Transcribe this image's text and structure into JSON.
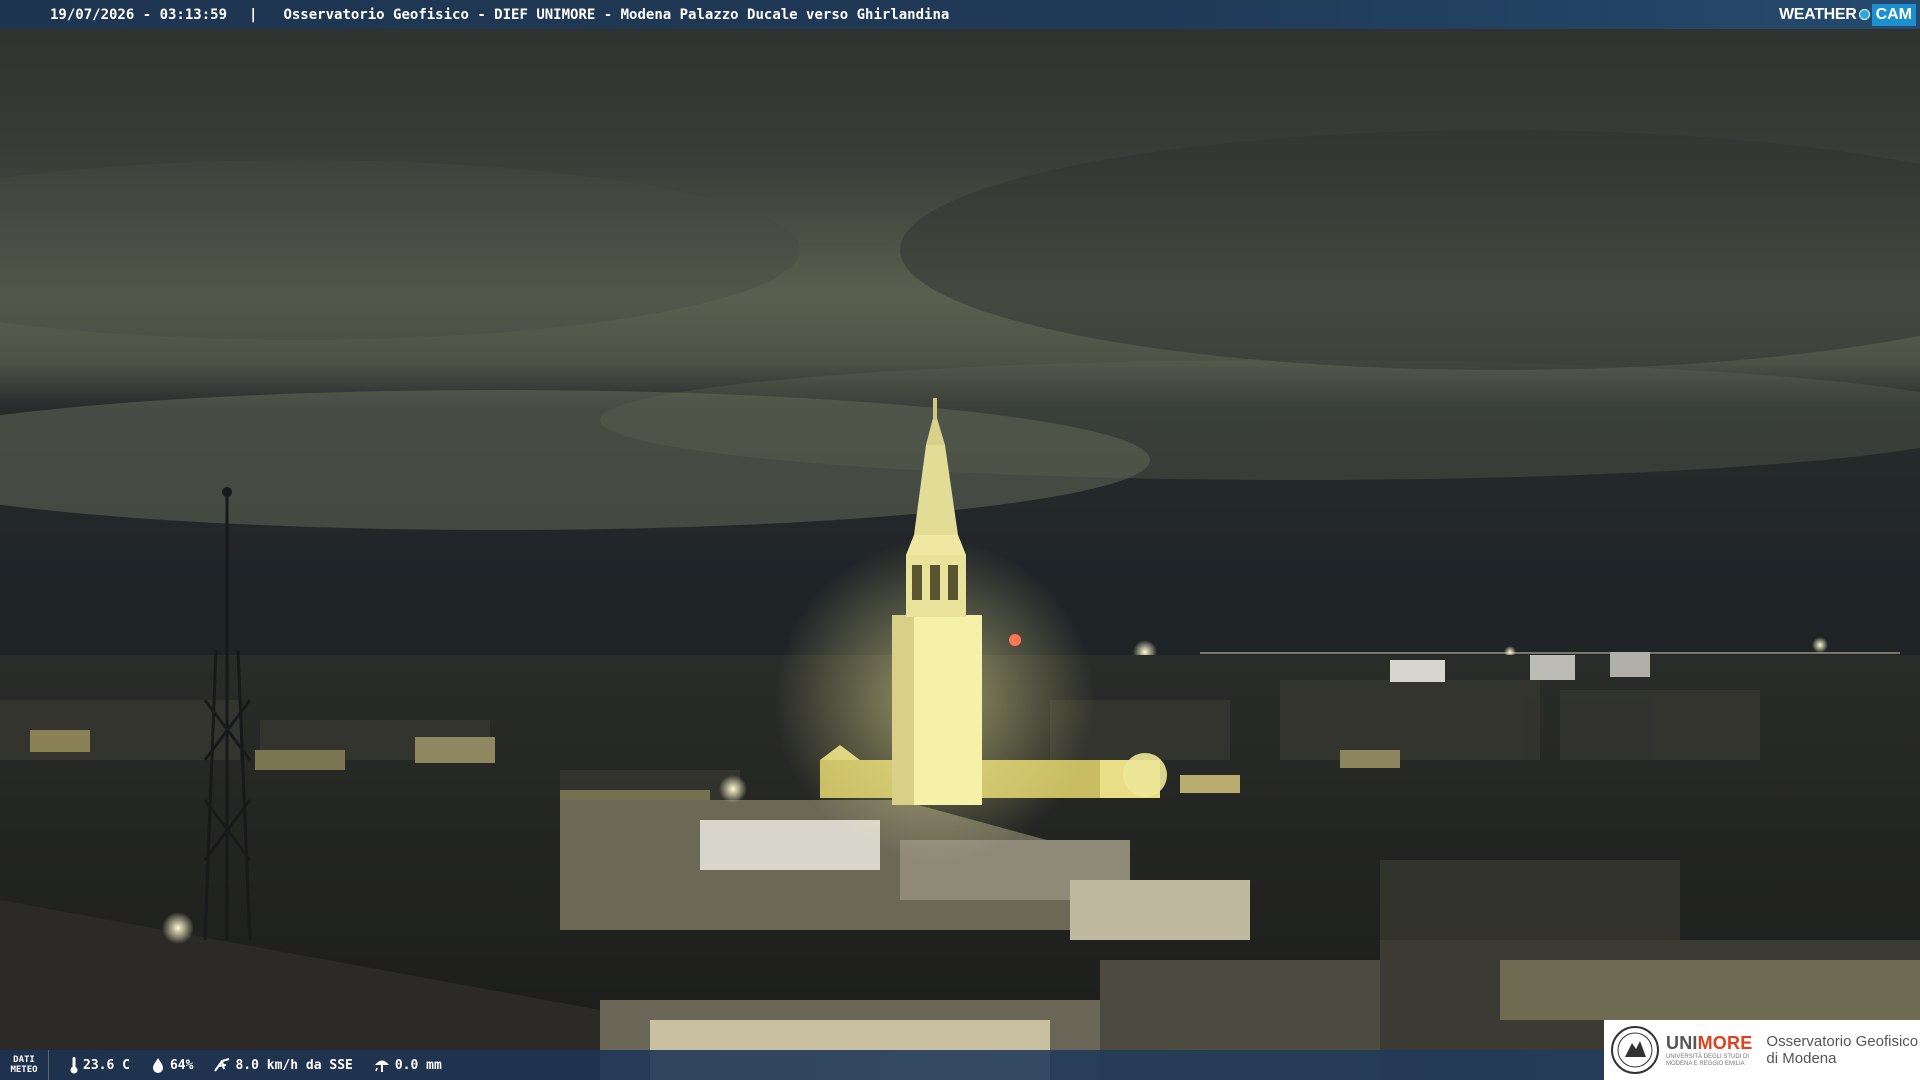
{
  "header": {
    "timestamp": "19/07/2026 - 03:13:59",
    "separator": "|",
    "title": "Osservatorio Geofisico - DIEF UNIMORE - Modena Palazzo Ducale verso Ghirlandina",
    "logo_weather": "WEATHER",
    "logo_cam": "CAM"
  },
  "weather_bar": {
    "label_line1": "DATI",
    "label_line2": "METEO",
    "temperature": "23.6 C",
    "humidity": "64%",
    "wind": "8.0 km/h da SSE",
    "rain": "0.0 mm",
    "icons": [
      "thermometer-icon",
      "drop-icon",
      "wind-icon",
      "rain-gauge-icon"
    ]
  },
  "sponsor": {
    "university_uni": "UNI",
    "university_more": "MORE",
    "university_sub": "UNIVERSITÀ DEGLI STUDI DI MODENA E REGGIO EMILIA",
    "observatory_line1": "Osservatorio Geofisico",
    "observatory_line2": "di Modena"
  },
  "colors": {
    "sky": "#3a3d37",
    "horizon_glow": "#6b7358",
    "tower_lit": "#f1ec9a",
    "topbar": "#1f3a57",
    "unimore_accent": "#e2401c",
    "weathercam_blue": "#1c8fd0"
  }
}
